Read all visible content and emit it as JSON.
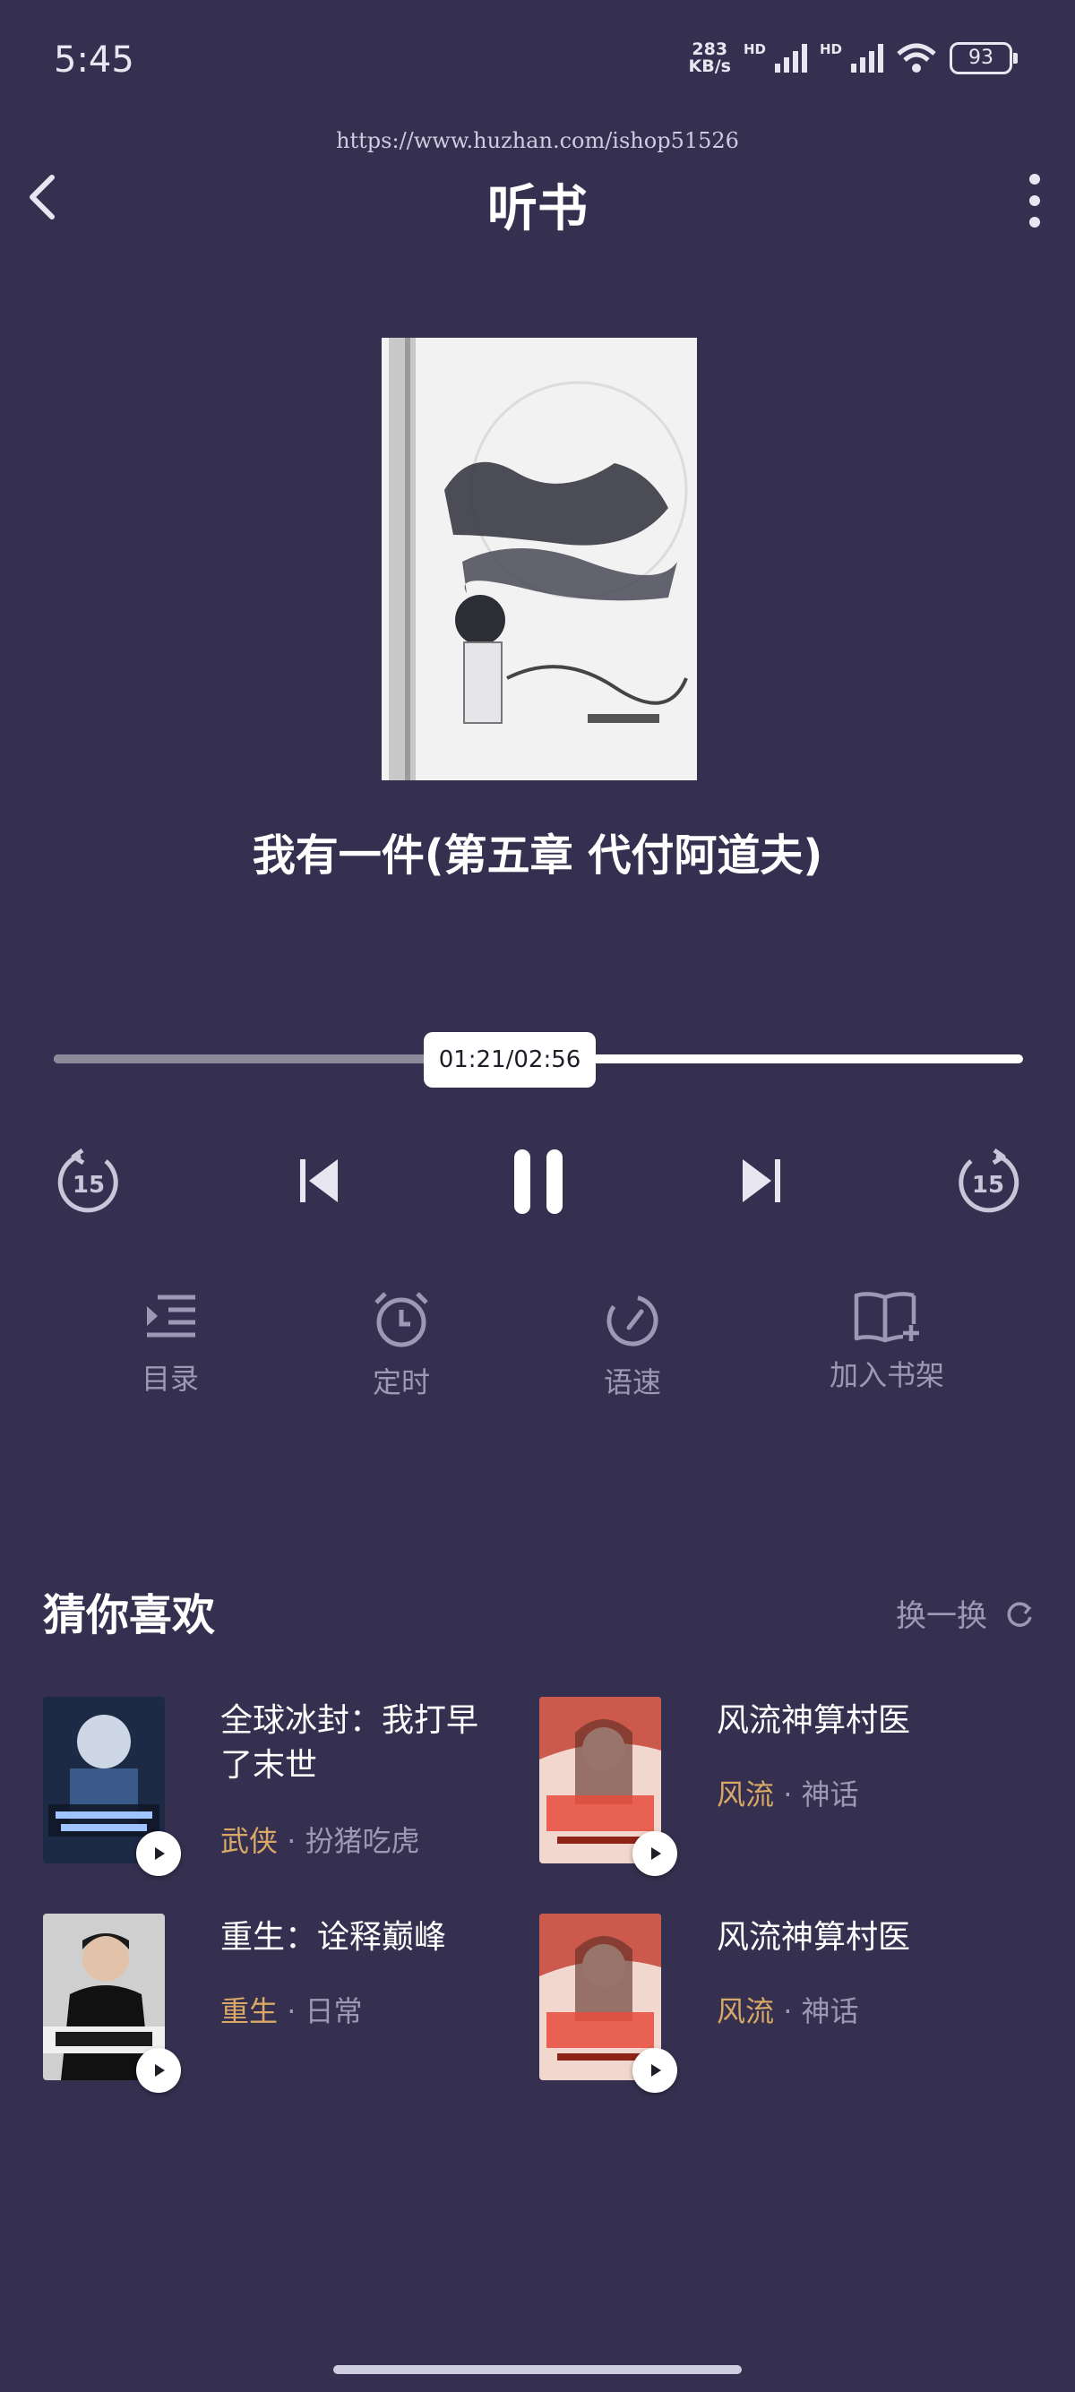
{
  "status": {
    "time": "5:45",
    "net_speed_value": "283",
    "net_speed_unit": "KB/s",
    "hd1": "HD",
    "hd2": "HD",
    "battery": "93"
  },
  "watermark": "https://www.huzhan.com/ishop51526",
  "header": {
    "title": "听书",
    "back_icon": "chevron-left-icon",
    "more_icon": "more-vertical-icon"
  },
  "player": {
    "chapter_title": "我有一件(第五章 代付阿道夫)",
    "time_display": "01:21/02:56",
    "progress": 0.46,
    "rewind_seconds": "15",
    "forward_seconds": "15",
    "state": "playing"
  },
  "functions": [
    {
      "label": "目录",
      "icon": "list-icon"
    },
    {
      "label": "定时",
      "icon": "alarm-clock-icon"
    },
    {
      "label": "语速",
      "icon": "speedometer-icon"
    },
    {
      "label": "加入书架",
      "icon": "book-add-icon"
    }
  ],
  "recommend": {
    "title": "猜你喜欢",
    "refresh_label": "换一换",
    "books": [
      {
        "name": "全球冰封：我打早了末世",
        "tag": "武侠",
        "subtag": "扮猪吃虎"
      },
      {
        "name": "风流神算村医",
        "tag": "风流",
        "subtag": "神话"
      },
      {
        "name": "重生：诠释巅峰",
        "tag": "重生",
        "subtag": "日常"
      },
      {
        "name": "风流神算村医",
        "tag": "风流",
        "subtag": "神话"
      }
    ]
  },
  "colors": {
    "background": "#35304f",
    "accent_tag": "#d9a866",
    "muted_text": "#9d99b4"
  }
}
